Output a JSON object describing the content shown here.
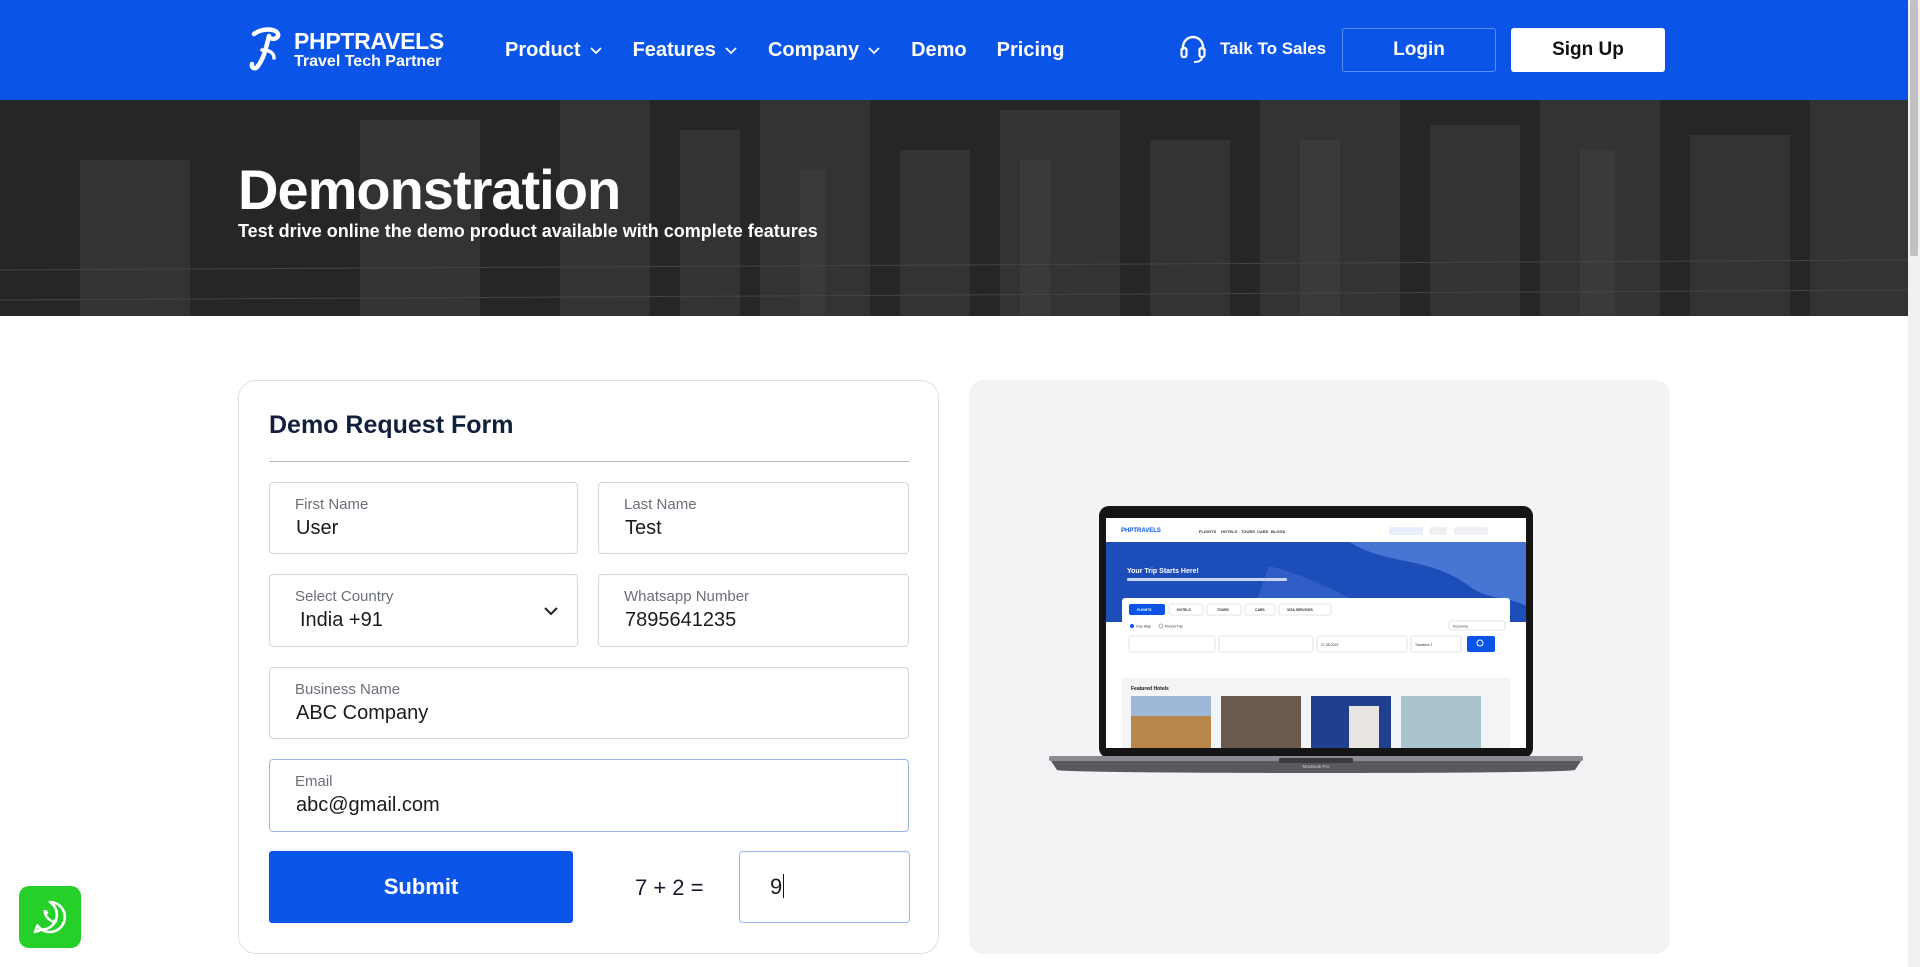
{
  "header": {
    "brand": {
      "name": "PHPTRAVELS",
      "tagline": "Travel Tech Partner"
    },
    "nav": [
      {
        "label": "Product",
        "has_dropdown": true
      },
      {
        "label": "Features",
        "has_dropdown": true
      },
      {
        "label": "Company",
        "has_dropdown": true
      },
      {
        "label": "Demo",
        "has_dropdown": false
      },
      {
        "label": "Pricing",
        "has_dropdown": false
      }
    ],
    "talk_to_sales": "Talk To Sales",
    "login": "Login",
    "signup": "Sign Up",
    "bg_color": "#0a55e8"
  },
  "hero": {
    "title": "Demonstration",
    "subtitle": "Test drive online the demo product available with complete features"
  },
  "form": {
    "title": "Demo Request Form",
    "first_name": {
      "label": "First Name",
      "value": "User"
    },
    "last_name": {
      "label": "Last Name",
      "value": "Test"
    },
    "country": {
      "label": "Select Country",
      "value": "India +91"
    },
    "whatsapp": {
      "label": "Whatsapp Number",
      "value": "7895641235"
    },
    "business": {
      "label": "Business Name",
      "value": "ABC Company"
    },
    "email": {
      "label": "Email",
      "value": "abc@gmail.com"
    },
    "submit": "Submit",
    "captcha": {
      "question": "7 + 2 =",
      "answer": "9"
    }
  },
  "preview": {
    "laptop_model": "MacBook Pro",
    "screen": {
      "brand": "PHPTRAVELS",
      "nav": [
        "FLIGHTS",
        "HOTELS",
        "TOURS",
        "CARS",
        "BLOGS"
      ],
      "hero_title": "Your Trip Starts Here!",
      "tabs": [
        "FLIGHTS",
        "HOTELS",
        "TOURS",
        "CARS",
        "VISA SERVICES"
      ],
      "trip_types": [
        "One Way",
        "Round Trip"
      ],
      "cabin": "Economy",
      "depart_date": "27-08-2023",
      "travellers": "Travellers 1",
      "featured": "Featured Hotels"
    }
  },
  "icons": {
    "whatsapp": "whatsapp-icon",
    "headset": "headset-icon",
    "chevron": "chevron-down-icon"
  }
}
